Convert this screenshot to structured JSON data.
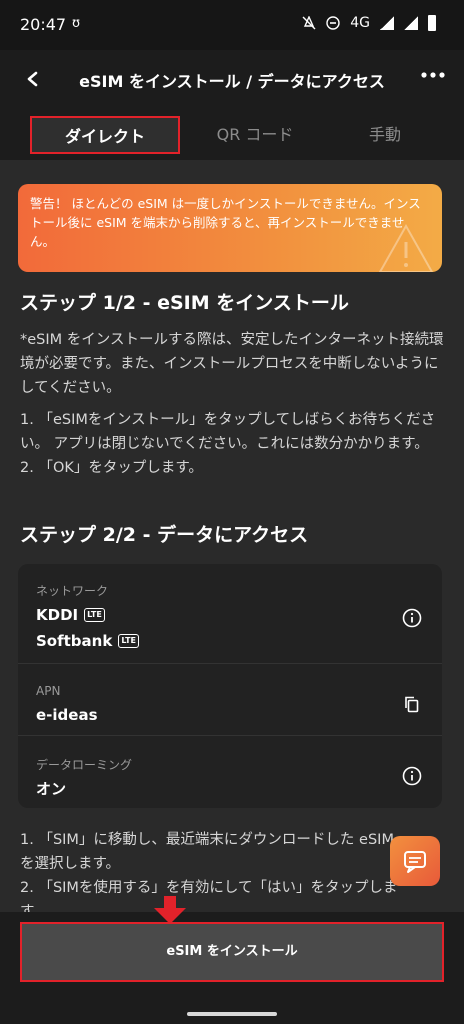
{
  "status": {
    "time": "20:47",
    "app_icon": "ʊ",
    "network": "4G"
  },
  "header": {
    "back_icon": "‹",
    "title": "eSIM をインストール / データにアクセス",
    "more_icon": "•••"
  },
  "tabs": [
    {
      "label": "ダイレクト"
    },
    {
      "label": "QR コード"
    },
    {
      "label": "手動"
    }
  ],
  "warning": {
    "text": "警告！ ほとんどの eSIM は一度しかインストールできません。インストール後に eSIM を端末から削除すると、再インストールできません。"
  },
  "step1": {
    "title": "ステップ 1/2 - eSIM をインストール",
    "note": "*eSIM をインストールする際は、安定したインターネット接続環境が必要です。また、インストールプロセスを中断しないようにしてください。",
    "instructions": "1. 「eSIMをインストール」をタップしてしばらくお待ちください。 アプリは閉じないでください。これには数分かかります。\n2. 「OK」をタップします。"
  },
  "step2": {
    "title": "ステップ 2/2 - データにアクセス",
    "network": {
      "label": "ネットワーク",
      "carriers": [
        {
          "name": "KDDI",
          "badge": "LTE"
        },
        {
          "name": "Softbank",
          "badge": "LTE"
        }
      ]
    },
    "apn": {
      "label": "APN",
      "value": "e-ideas"
    },
    "roaming": {
      "label": "データローミング",
      "value": "オン"
    },
    "instructions": "1. 「SIM」に移動し、最近端末にダウンロードした eSIMを選択します。\n2. 「SIMを使用する」を有効にして「はい」をタップします。"
  },
  "install_button": {
    "label": "eSIM をインストール"
  },
  "colors": {
    "accent": "#f26a3a",
    "highlight": "#e2222a"
  }
}
